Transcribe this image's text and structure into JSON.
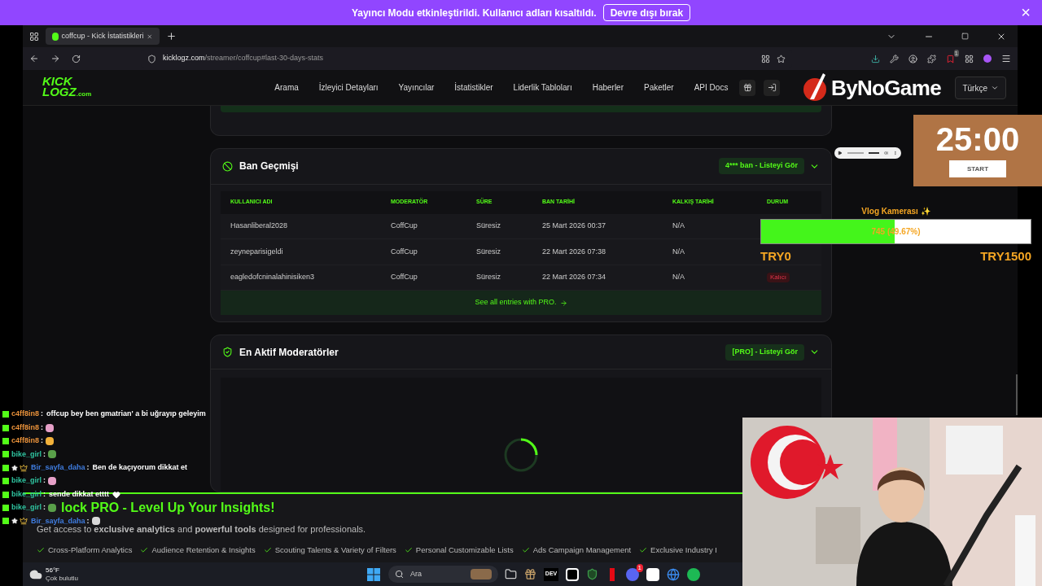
{
  "notice": {
    "text": "Yayıncı Modu etkinleştirildi. Kullanıcı adları kısaltıldı.",
    "button": "Devre dışı bırak",
    "close": "×"
  },
  "browser": {
    "tab_title": "coffcup - Kick İstatistikleri",
    "url_host": "kicklogz.com",
    "url_path": "/streamer/coffcup#last-30-days-stats",
    "extension_badge": "1"
  },
  "site": {
    "logo_top": "KICK",
    "logo_bottom": "LOGZ",
    "logo_suffix": ".com",
    "nav": [
      "Arama",
      "İzleyici Detayları",
      "Yayıncılar",
      "İstatistikler",
      "Liderlik Tabloları",
      "Haberler",
      "Paketler",
      "API Docs"
    ],
    "language": "Türkçe"
  },
  "ban_history": {
    "title": "Ban Geçmişi",
    "badge": "4*** ban - Listeyi Gör",
    "columns": [
      "KULLANICI ADI",
      "MODERATÖR",
      "SÜRE",
      "BAN TARİHİ",
      "KALKIŞ TARİHİ",
      "DURUM"
    ],
    "rows": [
      {
        "cells": [
          "Hasanliberal2028",
          "CoffCup",
          "Süresiz",
          "25 Mart 2026 00:37",
          "N/A"
        ]
      },
      {
        "cells": [
          "zeyneparisigeldi",
          "CoffCup",
          "Süresiz",
          "22 Mart 2026 07:38",
          "N/A"
        ]
      },
      {
        "cells": [
          "eagledofcninalahinisiken3",
          "CoffCup",
          "Süresiz",
          "22 Mart 2026 07:34",
          "N/A"
        ],
        "status": "Kalıcı"
      }
    ],
    "footer_link": "See all entries with PRO."
  },
  "moderators": {
    "title": "En Aktif Moderatörler",
    "badge": "[PRO] - Listeyi Gör",
    "loading": true
  },
  "pro_banner": {
    "title": "lock PRO - Level Up Your Insights!",
    "description": "Get access to **exclusive analytics** and **powerful tools** designed for professionals.",
    "features": [
      "Cross-Platform Analytics",
      "Audience Retention & Insights",
      "Scouting Talents & Variety of Filters",
      "Personal Customizable Lists",
      "Ads Campaign Management",
      "Exclusive Industry I"
    ]
  },
  "taskbar": {
    "temperature": "56°F",
    "condition": "Çok bulutlu",
    "search_placeholder": "Ara",
    "dev_label": "DEV",
    "discord_count": "1"
  },
  "overlay": {
    "brand": "ByNoGame",
    "timer": "25:00",
    "timer_button": "START",
    "goal": {
      "title": "Vlog Kamerası ✨",
      "level": 0.4967,
      "reading": "745 (49.67%)",
      "min": "TRY0",
      "max": "TRY1500"
    }
  },
  "chat": [
    {
      "user": "c4ff8in8",
      "separator": ":",
      "color": "#e8913a",
      "badges": false,
      "kind": "text",
      "text": "offcup bey ben gmatrian' a bi uğrayıp geleyim",
      "heart": false
    },
    {
      "user": "c4ff8in8",
      "separator": ":",
      "color": "#e8913a",
      "badges": false,
      "kind": "emote",
      "heart": false
    },
    {
      "user": "c4ff8in8",
      "separator": ":",
      "color": "#e8913a",
      "badges": false,
      "kind": "emote",
      "heart": false
    },
    {
      "user": "bike_girl",
      "separator": ":",
      "color": "#2fc4a0",
      "badges": false,
      "kind": "emote",
      "heart": false
    },
    {
      "user": "Bir_sayfa_daha",
      "separator": ":",
      "color": "#3f7de0",
      "badges": true,
      "kind": "text",
      "text": "Ben de kaçıyorum dikkat et",
      "heart": false
    },
    {
      "user": "bike_girl",
      "separator": ":",
      "color": "#2fc4a0",
      "badges": false,
      "kind": "emote",
      "heart": false
    },
    {
      "user": "bike_girl",
      "separator": ":",
      "color": "#2fc4a0",
      "badges": false,
      "kind": "text",
      "text": "sende dikkat etttt",
      "heart": true
    },
    {
      "user": "bike_girl",
      "separator": ":",
      "color": "#2fc4a0",
      "badges": false,
      "kind": "emote",
      "heart": false
    },
    {
      "user": "Bir_sayfa_daha",
      "separator": ":",
      "color": "#3f7de0",
      "badges": true,
      "kind": "emote",
      "heart": false
    }
  ]
}
